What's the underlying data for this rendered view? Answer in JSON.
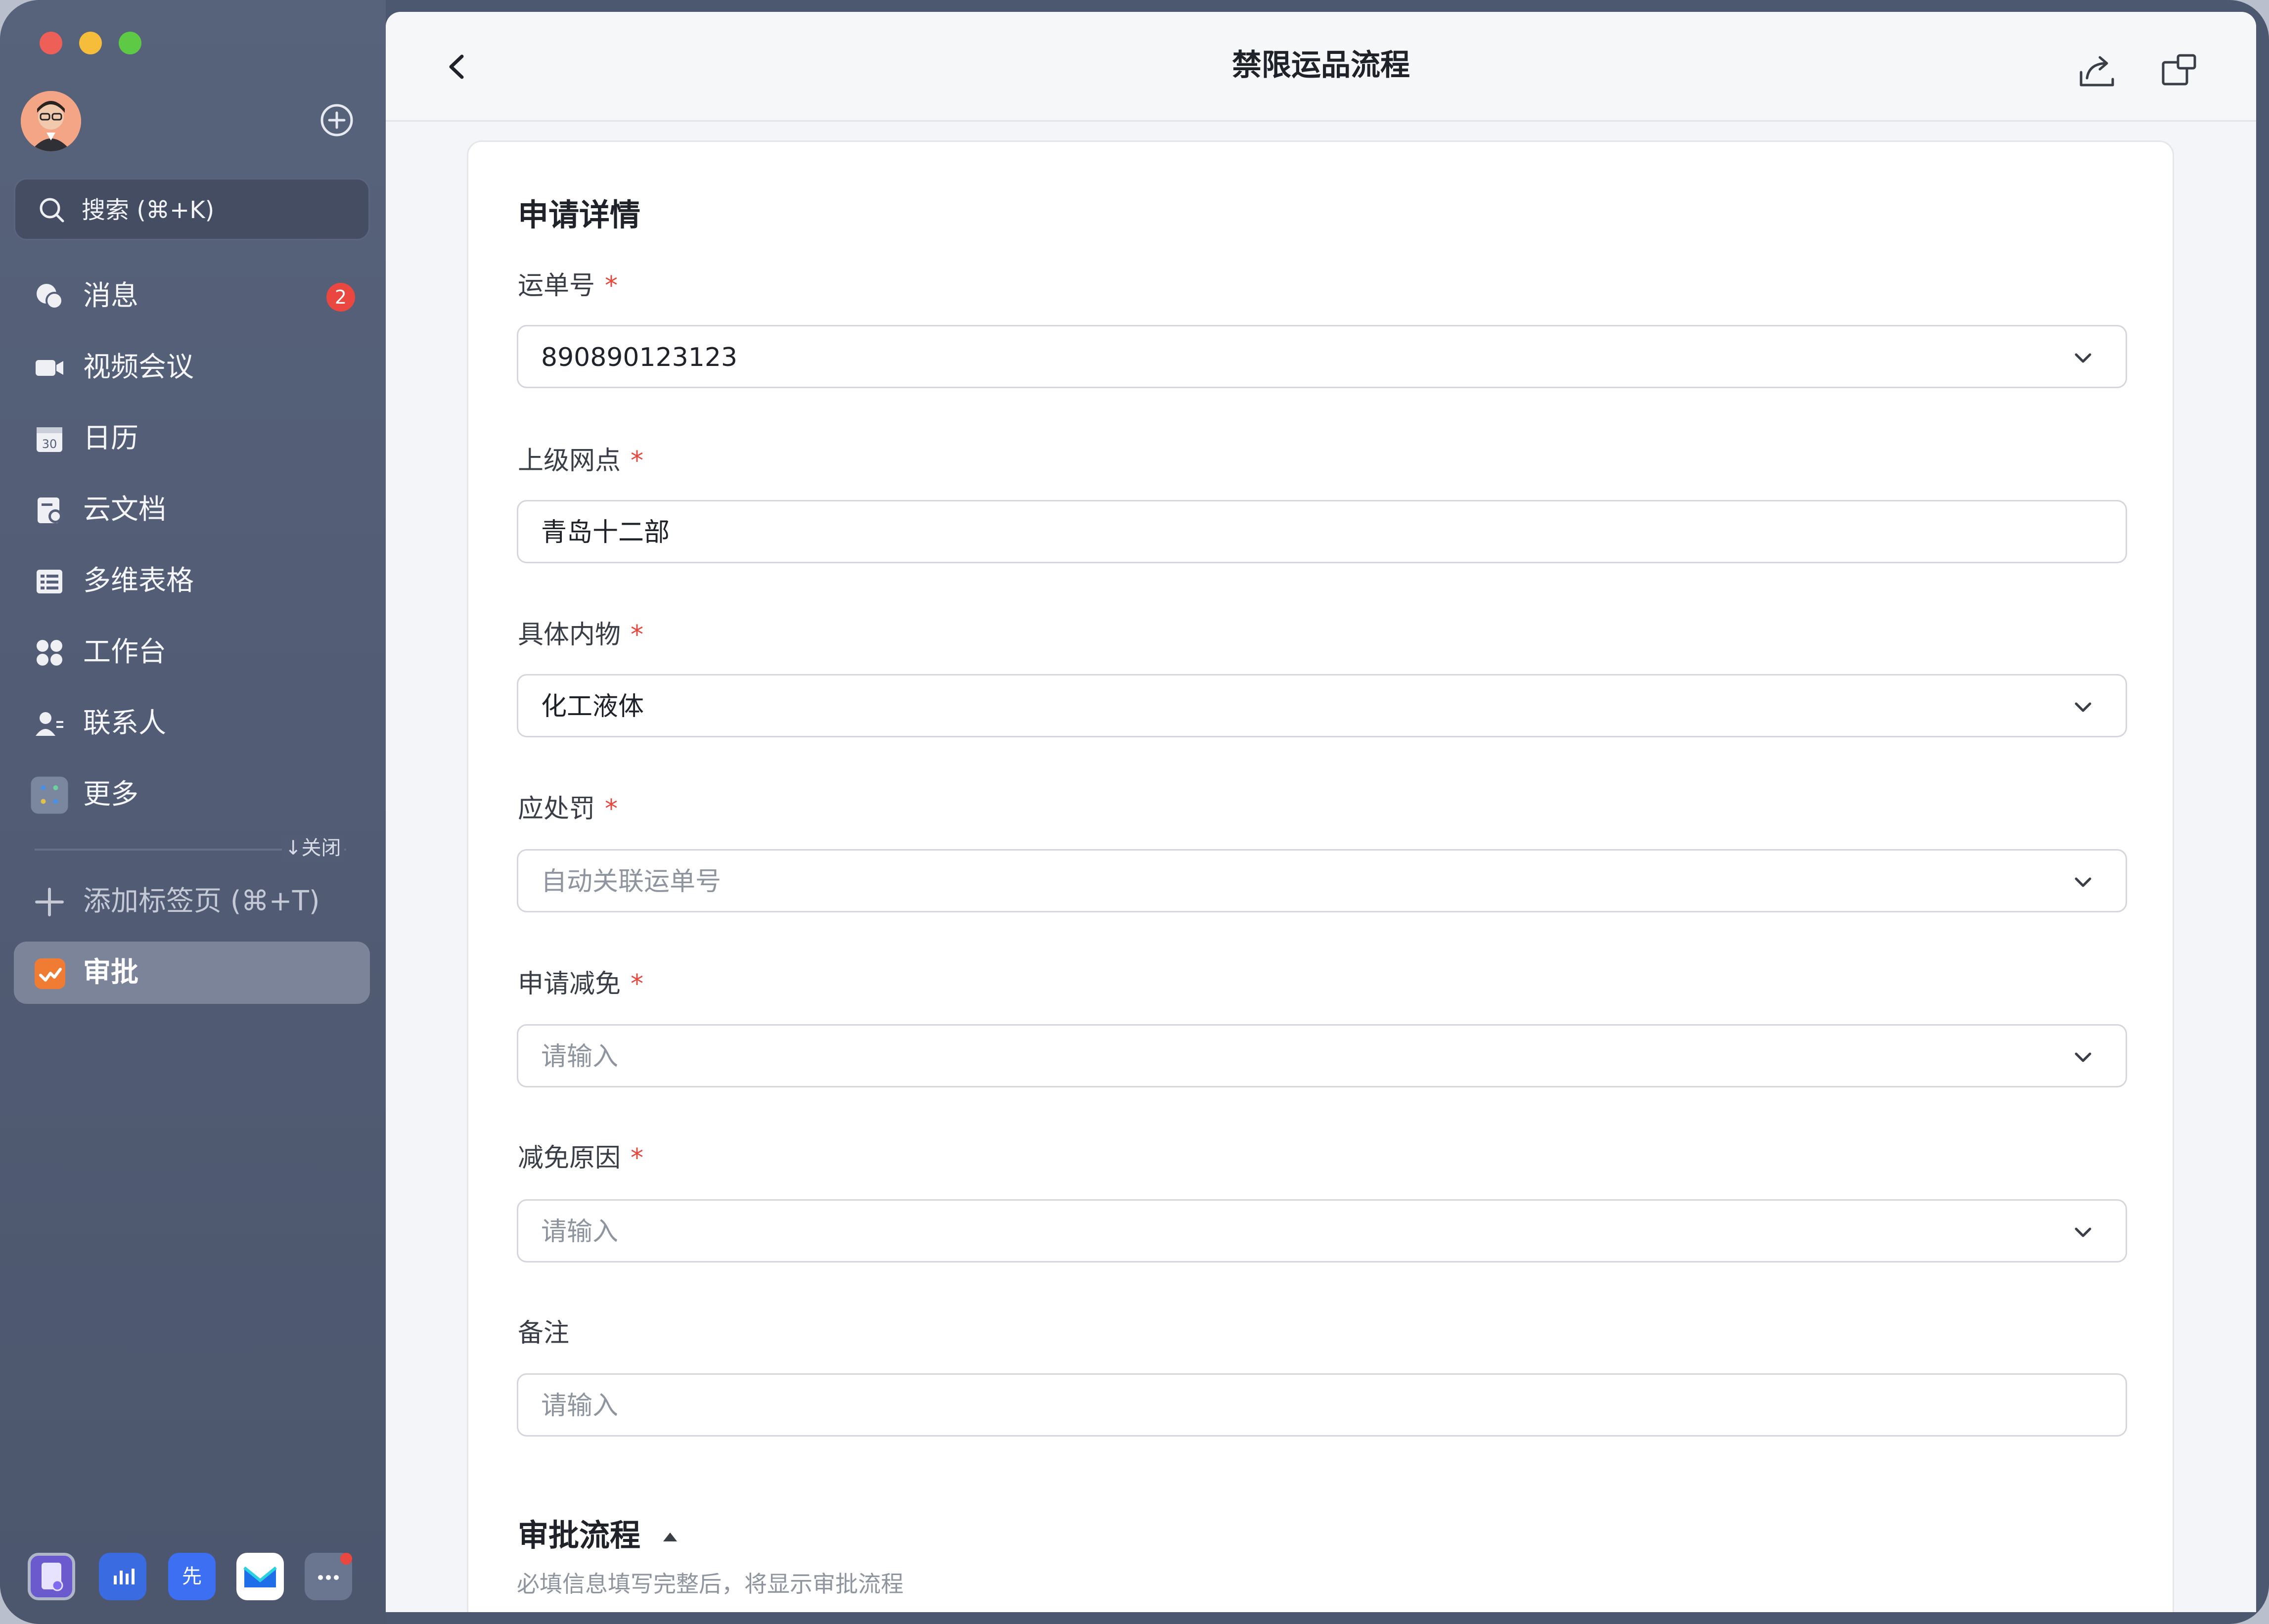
{
  "sidebar": {
    "search_label": "搜索 (⌘+K)",
    "items": [
      {
        "label": "消息",
        "icon": "chat-bubble-icon",
        "badge": "2"
      },
      {
        "label": "视频会议",
        "icon": "video-camera-icon"
      },
      {
        "label": "日历",
        "icon": "calendar-icon"
      },
      {
        "label": "云文档",
        "icon": "cloud-document-icon"
      },
      {
        "label": "多维表格",
        "icon": "table-icon"
      },
      {
        "label": "工作台",
        "icon": "grid-apps-icon"
      },
      {
        "label": "联系人",
        "icon": "contacts-icon"
      },
      {
        "label": "更多",
        "icon": "more-apps-icon"
      }
    ],
    "close_label": "↓关闭",
    "add_tab_label": "添加标签页 (⌘+T)",
    "active_item_label": "审批",
    "dock_icons": [
      "notes-app-icon",
      "chart-app-icon",
      "xian-app-icon",
      "mail-app-icon",
      "more-dots-icon"
    ],
    "dock_xian_text": "先"
  },
  "header": {
    "title": "禁限运品流程"
  },
  "form": {
    "section_title": "申请详情",
    "fields": [
      {
        "label": "运单号",
        "required": true,
        "value": "890890123123",
        "placeholder": "",
        "type": "select"
      },
      {
        "label": "上级网点",
        "required": true,
        "value": "青岛十二部",
        "placeholder": "",
        "type": "input"
      },
      {
        "label": "具体内物",
        "required": true,
        "value": "化工液体",
        "placeholder": "",
        "type": "select"
      },
      {
        "label": "应处罚",
        "required": true,
        "value": "",
        "placeholder": "自动关联运单号",
        "type": "select"
      },
      {
        "label": "申请减免",
        "required": true,
        "value": "",
        "placeholder": "请输入",
        "type": "select"
      },
      {
        "label": "减免原因",
        "required": true,
        "value": "",
        "placeholder": "请输入",
        "type": "select"
      },
      {
        "label": "备注",
        "required": false,
        "value": "",
        "placeholder": "请输入",
        "type": "input"
      }
    ],
    "required_mark": "*",
    "flow_title": "审批流程",
    "flow_hint": "必填信息填写完整后，将显示审批流程"
  },
  "colors": {
    "sidebar_bg": "#525c74",
    "accent_orange": "#f07b32",
    "badge_red": "#e9473f",
    "required_red": "#e8473e"
  }
}
